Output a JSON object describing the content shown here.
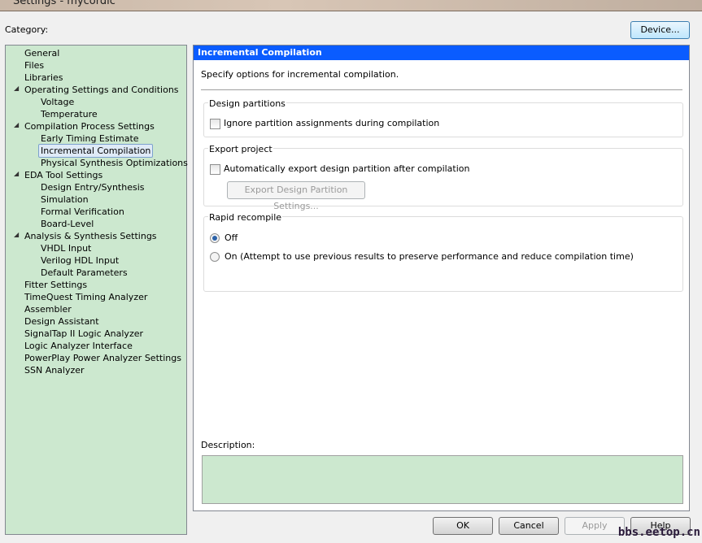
{
  "window": {
    "title": "Settings - mycordic"
  },
  "category_label": "Category:",
  "device_button": "Device...",
  "tree": [
    {
      "label": "General",
      "level": 0
    },
    {
      "label": "Files",
      "level": 0
    },
    {
      "label": "Libraries",
      "level": 0
    },
    {
      "label": "Operating Settings and Conditions",
      "level": 0,
      "expanded": true
    },
    {
      "label": "Voltage",
      "level": 1
    },
    {
      "label": "Temperature",
      "level": 1
    },
    {
      "label": "Compilation Process Settings",
      "level": 0,
      "expanded": true
    },
    {
      "label": "Early Timing Estimate",
      "level": 1
    },
    {
      "label": "Incremental Compilation",
      "level": 1,
      "selected": true
    },
    {
      "label": "Physical Synthesis Optimizations",
      "level": 1
    },
    {
      "label": "EDA Tool Settings",
      "level": 0,
      "expanded": true
    },
    {
      "label": "Design Entry/Synthesis",
      "level": 1
    },
    {
      "label": "Simulation",
      "level": 1
    },
    {
      "label": "Formal Verification",
      "level": 1
    },
    {
      "label": "Board-Level",
      "level": 1
    },
    {
      "label": "Analysis & Synthesis Settings",
      "level": 0,
      "expanded": true
    },
    {
      "label": "VHDL Input",
      "level": 1
    },
    {
      "label": "Verilog HDL Input",
      "level": 1
    },
    {
      "label": "Default Parameters",
      "level": 1
    },
    {
      "label": "Fitter Settings",
      "level": 0
    },
    {
      "label": "TimeQuest Timing Analyzer",
      "level": 0
    },
    {
      "label": "Assembler",
      "level": 0
    },
    {
      "label": "Design Assistant",
      "level": 0
    },
    {
      "label": "SignalTap II Logic Analyzer",
      "level": 0
    },
    {
      "label": "Logic Analyzer Interface",
      "level": 0
    },
    {
      "label": "PowerPlay Power Analyzer Settings",
      "level": 0
    },
    {
      "label": "SSN Analyzer",
      "level": 0
    }
  ],
  "panel": {
    "title": "Incremental Compilation",
    "intro": "Specify options for incremental compilation.",
    "design_partitions": {
      "title": "Design partitions",
      "checkbox": "Ignore partition assignments during compilation",
      "checked": false
    },
    "export_project": {
      "title": "Export project",
      "checkbox": "Automatically export design partition after compilation",
      "checked": false,
      "settings_button": "Export Design Partition Settings..."
    },
    "rapid_recompile": {
      "title": "Rapid recompile",
      "off": "Off",
      "on": "On (Attempt to use previous results to preserve performance and reduce compilation time)",
      "selected": "Off"
    },
    "description_label": "Description:"
  },
  "buttons": {
    "ok": "OK",
    "cancel": "Cancel",
    "apply": "Apply",
    "help": "Help"
  },
  "watermark": "bbs.eetop.cn"
}
